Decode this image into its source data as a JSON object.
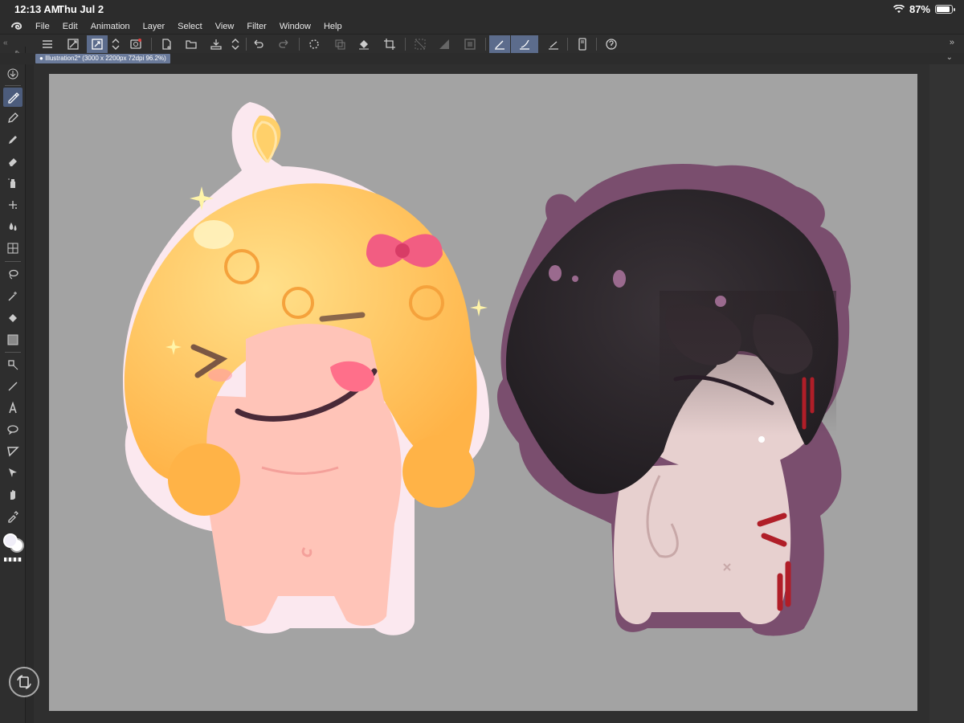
{
  "status": {
    "time": "12:13 AM",
    "date": "Thu Jul 2",
    "battery": "87%",
    "battery_level": 0.87
  },
  "menu": {
    "items": [
      "File",
      "Edit",
      "Animation",
      "Layer",
      "Select",
      "View",
      "Filter",
      "Window",
      "Help"
    ]
  },
  "command_bar": {
    "icons": [
      "menu-icon",
      "expand-icon",
      "transform-icon",
      "stepper-icon",
      "record-icon",
      "new-icon",
      "open-icon",
      "save-icon",
      "stepper-icon",
      "undo-icon",
      "redo-icon",
      "loading-icon",
      "copy-icon",
      "fill-icon",
      "crop-icon",
      "deselect-icon",
      "gradient-icon",
      "border-icon",
      "pen-ruler-icon",
      "brush-ruler-icon",
      "line-ruler-icon",
      "phone-icon",
      "help-icon"
    ]
  },
  "document_tab": {
    "title": "Illustration2* (3000 x 2200px 72dpi 96.2%)"
  },
  "tools": [
    "download-icon",
    "pen-icon",
    "pencil-icon",
    "marker-icon",
    "eraser-icon",
    "spray-icon",
    "sparkle-icon",
    "blend-icon",
    "grid-icon",
    "lasso-icon",
    "magic-wand-icon",
    "fill-bucket-icon",
    "gradient-icon",
    "shape-icon",
    "line-icon",
    "text-icon",
    "speech-bubble-icon",
    "frame-icon",
    "move-icon",
    "hand-icon",
    "eyedropper-icon"
  ],
  "colors": {
    "main": "#f0eef8",
    "sub": "#ffffff",
    "accent": "#5c6c8c",
    "canvas_bg": "#a3a3a3"
  }
}
